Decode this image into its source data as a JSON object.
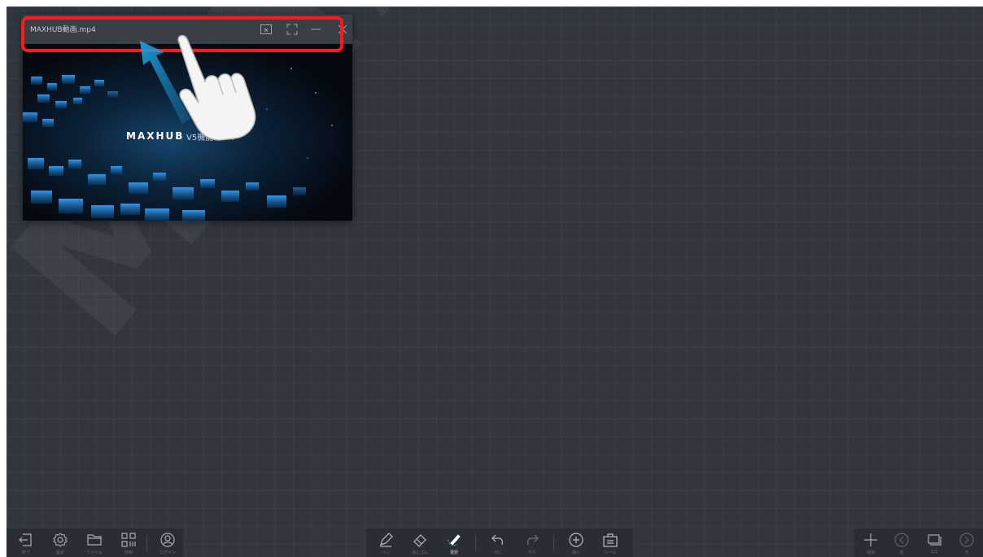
{
  "video_window": {
    "title": "MAXHUB動画.mp4",
    "brand_text": "MAXHUB",
    "subtitle_text": "V5機能ハ　ト"
  },
  "watermark_text": "MAYA",
  "left_toolbar": {
    "items": [
      {
        "label": "終了",
        "icon": "exit-icon"
      },
      {
        "label": "設定",
        "icon": "gear-icon"
      },
      {
        "label": "ファイル",
        "icon": "folder-icon"
      },
      {
        "label": "共有",
        "icon": "qr-code-icon"
      },
      {
        "label": "ログイン",
        "icon": "user-icon"
      }
    ]
  },
  "center_toolbar": {
    "items": [
      {
        "label": "ペン",
        "icon": "pen-icon"
      },
      {
        "label": "消しゴム",
        "icon": "eraser-icon"
      },
      {
        "label": "選択",
        "icon": "select-icon",
        "active": true
      },
      {
        "label": "元に",
        "icon": "undo-icon"
      },
      {
        "label": "やり",
        "icon": "redo-icon"
      },
      {
        "label": "挿入",
        "icon": "insert-icon"
      },
      {
        "label": "ツール",
        "icon": "toolbox-icon"
      }
    ]
  },
  "right_toolbar": {
    "items": [
      {
        "label": "追加",
        "icon": "plus-icon"
      },
      {
        "label": "前",
        "icon": "prev-page-icon"
      },
      {
        "label": "1/1",
        "icon": "pages-icon"
      },
      {
        "label": "次",
        "icon": "next-page-icon"
      }
    ]
  },
  "colors": {
    "canvas": "#32363e",
    "toolbar": "#2a2d34",
    "highlight": "#ff1a1a",
    "arrow": "#1e9ad6",
    "active_tool": "#3b8fe0"
  }
}
